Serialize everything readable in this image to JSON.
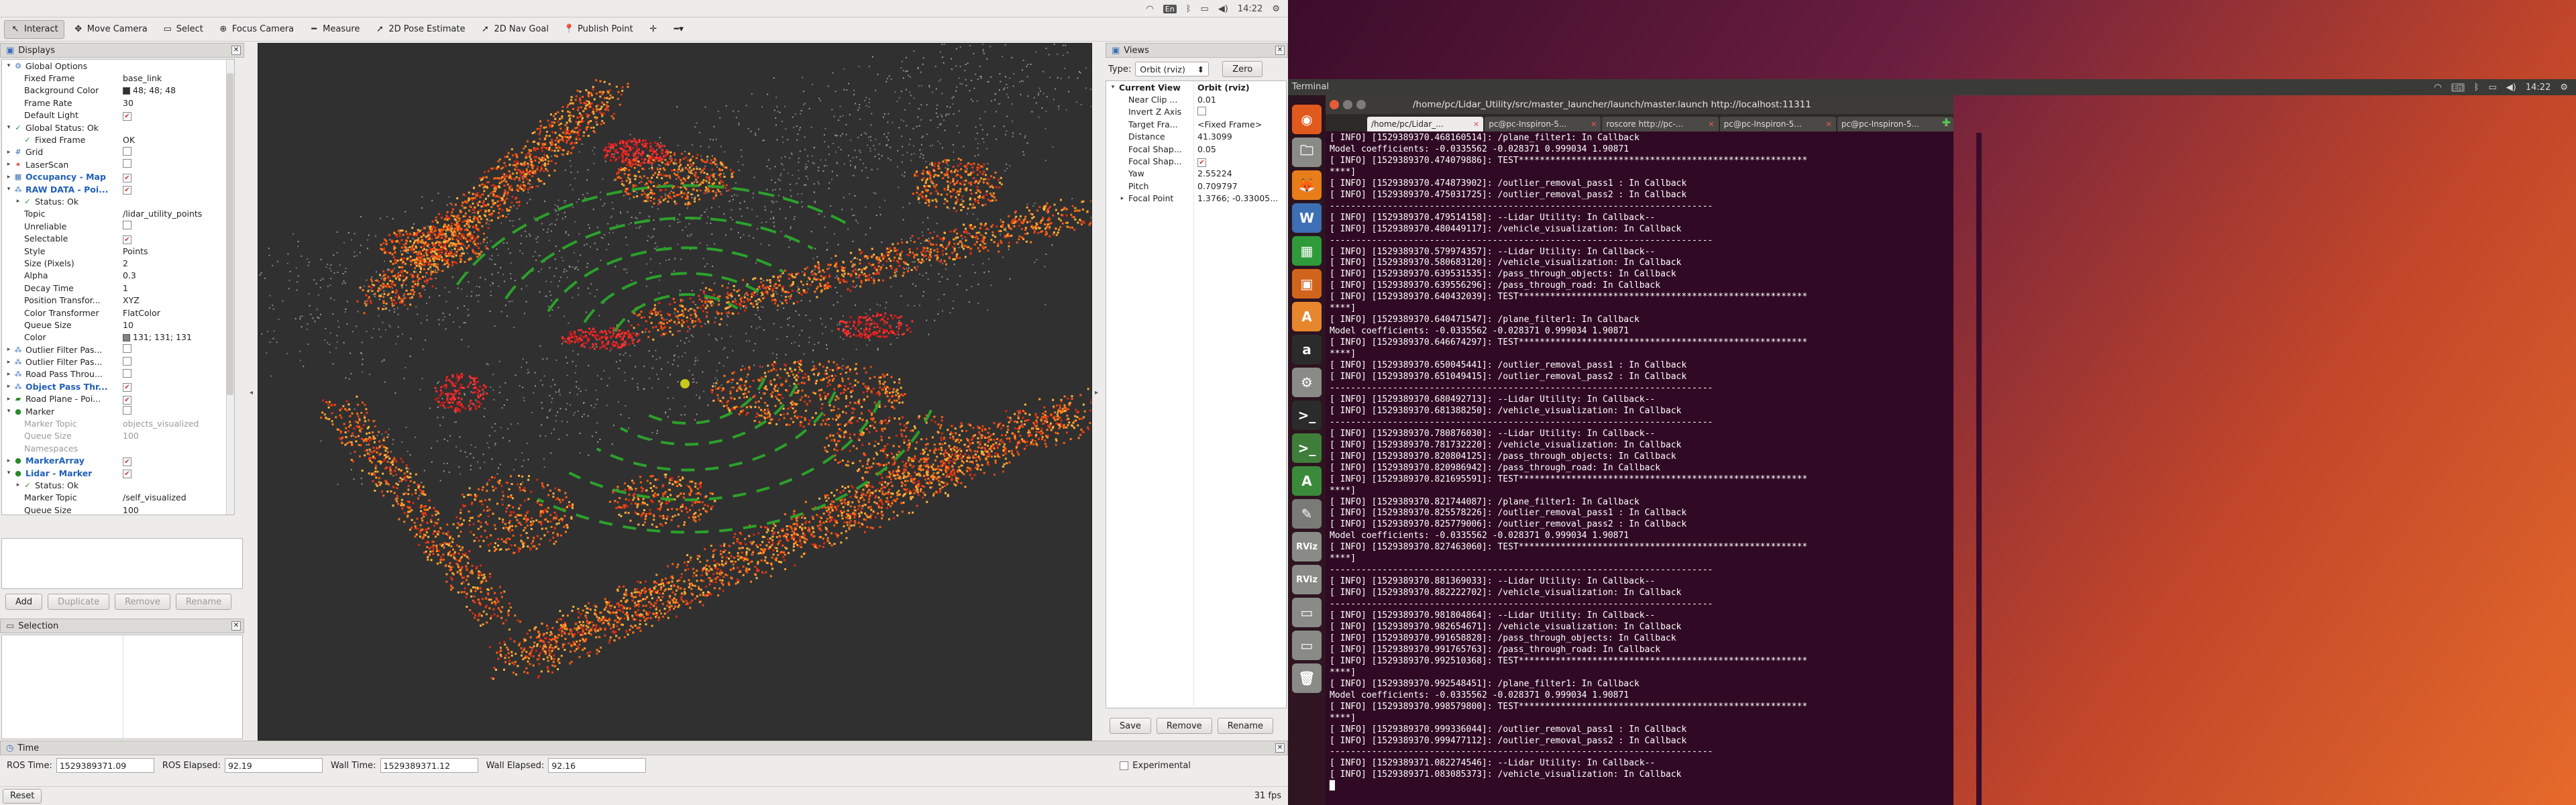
{
  "rviz": {
    "tray": {
      "time": "14:22",
      "en": "En"
    },
    "toolbar": [
      {
        "name": "interact",
        "label": "Interact",
        "icon": "↖",
        "active": true
      },
      {
        "name": "move-camera",
        "label": "Move Camera",
        "icon": "✥"
      },
      {
        "name": "select",
        "label": "Select",
        "icon": "▭"
      },
      {
        "name": "focus-camera",
        "label": "Focus Camera",
        "icon": "⊕"
      },
      {
        "name": "measure",
        "label": "Measure",
        "icon": "━"
      },
      {
        "name": "pose-estimate",
        "label": "2D Pose Estimate",
        "icon": "➚"
      },
      {
        "name": "nav-goal",
        "label": "2D Nav Goal",
        "icon": "➚"
      },
      {
        "name": "publish-point",
        "label": "Publish Point",
        "icon": "📍"
      },
      {
        "name": "plus-tool",
        "label": "",
        "icon": "✛"
      },
      {
        "name": "more-tools",
        "label": "",
        "icon": "━▾"
      }
    ],
    "displays_title": "Displays",
    "display_rows": [
      {
        "d": 0,
        "arrow": "▾",
        "icon": "⚙",
        "icolor": "#3a6fb5",
        "k": "Global Options",
        "v": ""
      },
      {
        "d": 1,
        "k": "Fixed Frame",
        "v": "base_link"
      },
      {
        "d": 1,
        "k": "Background Color",
        "v": "48; 48; 48",
        "swatch": "#303030"
      },
      {
        "d": 1,
        "k": "Frame Rate",
        "v": "30"
      },
      {
        "d": 1,
        "k": "Default Light",
        "chk": true
      },
      {
        "d": 0,
        "arrow": "▾",
        "icon": "✓",
        "icolor": "#2a8a2a",
        "k": "Global Status: Ok",
        "v": ""
      },
      {
        "d": 1,
        "icon": "✓",
        "icolor": "#2a8a2a",
        "k": "Fixed Frame",
        "v": "OK"
      },
      {
        "d": 0,
        "arrow": "▸",
        "icon": "#",
        "icolor": "#3a6fb5",
        "k": "Grid",
        "chk": false
      },
      {
        "d": 0,
        "arrow": "▸",
        "icon": "✶",
        "icolor": "#d33",
        "k": "LaserScan",
        "chk": false
      },
      {
        "d": 0,
        "arrow": "▸",
        "icon": "▦",
        "icolor": "#3a6fb5",
        "k": "Occupancy - Map",
        "blue": true,
        "chk": true
      },
      {
        "d": 0,
        "arrow": "▾",
        "icon": "⁂",
        "icolor": "#3a6fb5",
        "k": "RAW DATA - Poi...",
        "blue": true,
        "chk": true
      },
      {
        "d": 1,
        "arrow": "▸",
        "icon": "✓",
        "icolor": "#2a8a2a",
        "k": "Status: Ok",
        "v": ""
      },
      {
        "d": 1,
        "k": "Topic",
        "v": "/lidar_utility_points"
      },
      {
        "d": 1,
        "k": "Unreliable",
        "chk": false
      },
      {
        "d": 1,
        "k": "Selectable",
        "chk": true
      },
      {
        "d": 1,
        "k": "Style",
        "v": "Points"
      },
      {
        "d": 1,
        "k": "Size (Pixels)",
        "v": "2"
      },
      {
        "d": 1,
        "k": "Alpha",
        "v": "0.3"
      },
      {
        "d": 1,
        "k": "Decay Time",
        "v": "1"
      },
      {
        "d": 1,
        "k": "Position Transfor...",
        "v": "XYZ"
      },
      {
        "d": 1,
        "k": "Color Transformer",
        "v": "FlatColor"
      },
      {
        "d": 1,
        "k": "Queue Size",
        "v": "10"
      },
      {
        "d": 1,
        "k": "Color",
        "v": "131; 131; 131",
        "swatch": "#838383"
      },
      {
        "d": 0,
        "arrow": "▸",
        "icon": "⁂",
        "icolor": "#3a6fb5",
        "k": "Outlier Filter Pas...",
        "chk": false
      },
      {
        "d": 0,
        "arrow": "▸",
        "icon": "⁂",
        "icolor": "#3a6fb5",
        "k": "Outlier Filter Pas...",
        "chk": false
      },
      {
        "d": 0,
        "arrow": "▸",
        "icon": "⁂",
        "icolor": "#3a6fb5",
        "k": "Road Pass Throu...",
        "chk": false
      },
      {
        "d": 0,
        "arrow": "▸",
        "icon": "⁂",
        "icolor": "#3a6fb5",
        "k": "Object Pass Thr...",
        "blue": true,
        "chk": true
      },
      {
        "d": 0,
        "arrow": "▸",
        "icon": "▰",
        "icolor": "#2a8a2a",
        "k": "Road Plane - Poi...",
        "chk": true
      },
      {
        "d": 0,
        "arrow": "▾",
        "icon": "●",
        "icolor": "#2a8a2a",
        "k": "Marker",
        "chk": false
      },
      {
        "d": 1,
        "k": "Marker Topic",
        "v": "objects_visualized",
        "grey": true
      },
      {
        "d": 1,
        "k": "Queue Size",
        "v": "100",
        "grey": true
      },
      {
        "d": 1,
        "k": "Namespaces",
        "v": "",
        "grey": true
      },
      {
        "d": 0,
        "arrow": "▸",
        "icon": "●",
        "icolor": "#2a8a2a",
        "k": "MarkerArray",
        "blue": true,
        "chk": true
      },
      {
        "d": 0,
        "arrow": "▾",
        "icon": "●",
        "icolor": "#2a8a2a",
        "k": "Lidar - Marker",
        "blue": true,
        "chk": true
      },
      {
        "d": 1,
        "arrow": "▸",
        "icon": "✓",
        "icolor": "#2a8a2a",
        "k": "Status: Ok",
        "v": ""
      },
      {
        "d": 1,
        "k": "Marker Topic",
        "v": "/self_visualized"
      },
      {
        "d": 1,
        "k": "Queue Size",
        "v": "100"
      }
    ],
    "display_buttons": [
      "Add",
      "Duplicate",
      "Remove",
      "Rename"
    ],
    "selection_title": "Selection",
    "views_title": "Views",
    "views_type_label": "Type:",
    "views_type_value": "Orbit (rviz)",
    "views_zero": "Zero",
    "view_rows": [
      {
        "d": 0,
        "arrow": "▾",
        "k": "Current View",
        "v": "Orbit (rviz)",
        "bold": true
      },
      {
        "d": 1,
        "k": "Near Clip ...",
        "v": "0.01"
      },
      {
        "d": 1,
        "k": "Invert Z Axis",
        "chk": false
      },
      {
        "d": 1,
        "k": "Target Fra...",
        "v": "<Fixed Frame>"
      },
      {
        "d": 1,
        "k": "Distance",
        "v": "41.3099"
      },
      {
        "d": 1,
        "k": "Focal Shap...",
        "v": "0.05"
      },
      {
        "d": 1,
        "k": "Focal Shap...",
        "chk": true
      },
      {
        "d": 1,
        "k": "Yaw",
        "v": "2.55224"
      },
      {
        "d": 1,
        "k": "Pitch",
        "v": "0.709797"
      },
      {
        "d": 1,
        "arrow": "▸",
        "k": "Focal Point",
        "v": "1.3766; -0.33005..."
      }
    ],
    "views_buttons": [
      "Save",
      "Remove",
      "Rename"
    ],
    "time_title": "Time",
    "time": {
      "ros_time_label": "ROS Time:",
      "ros_time": "1529389371.09",
      "ros_elapsed_label": "ROS Elapsed:",
      "ros_elapsed": "92.19",
      "wall_time_label": "Wall Time:",
      "wall_time": "1529389371.12",
      "wall_elapsed_label": "Wall Elapsed:",
      "wall_elapsed": "92.16",
      "experimental": "Experimental"
    },
    "reset": "Reset",
    "fps": "31 fps"
  },
  "desktop": {
    "panel_title": "Terminal",
    "tray": {
      "time": "14:22",
      "en": "En"
    },
    "terminal_title": "/home/pc/Lidar_Utility/src/master_launcher/launch/master.launch http://localhost:11311",
    "tabs": [
      "/home/pc/Lidar_...",
      "pc@pc-Inspiron-5...",
      "roscore http://pc-...",
      "pc@pc-Inspiron-5...",
      "pc@pc-Inspiron-5..."
    ],
    "launcher": [
      {
        "name": "ubuntu-dash-icon",
        "glyph": "◉",
        "bg": "#e05a1e"
      },
      {
        "name": "files-icon",
        "glyph": "🗀",
        "bg": "#8a8a86"
      },
      {
        "name": "firefox-icon",
        "glyph": "🦊",
        "bg": "#e87d1a"
      },
      {
        "name": "writer-icon",
        "glyph": "W",
        "bg": "#3d6fb4"
      },
      {
        "name": "calc-icon",
        "glyph": "▦",
        "bg": "#2f9a3a"
      },
      {
        "name": "impress-icon",
        "glyph": "▣",
        "bg": "#d1641c"
      },
      {
        "name": "software-center-icon",
        "glyph": "A",
        "bg": "#e8862e"
      },
      {
        "name": "amazon-icon",
        "glyph": "a",
        "bg": "#2b2b2b"
      },
      {
        "name": "settings-icon",
        "glyph": "⚙",
        "bg": "#8a8a86"
      },
      {
        "name": "terminal-icon",
        "glyph": ">_",
        "bg": "#2b2b2b"
      },
      {
        "name": "terminal-icon-2",
        "glyph": ">_",
        "bg": "#3f7e3a"
      },
      {
        "name": "atom-icon",
        "glyph": "A",
        "bg": "#3b8a3b"
      },
      {
        "name": "text-editor-icon",
        "glyph": "✎",
        "bg": "#7a7a76"
      },
      {
        "name": "rviz-icon",
        "glyph": "RViz",
        "bg": "#8a8a86"
      },
      {
        "name": "rviz-icon-2",
        "glyph": "RViz",
        "bg": "#8a8a86"
      },
      {
        "name": "drive-icon",
        "glyph": "▭",
        "bg": "#8a8a86"
      },
      {
        "name": "drive-icon-2",
        "glyph": "▭",
        "bg": "#8a8a86"
      },
      {
        "name": "trash-icon",
        "glyph": "🗑",
        "bg": "#8a8a86"
      }
    ],
    "terminal_lines": [
      "[ INFO] [1529389370.468160514]: /plane_filter1: In Callback",
      "Model coefficients: -0.0335562 -0.028371 0.999034 1.90871",
      "[ INFO] [1529389370.474079886]: TEST*******************************************************",
      "****]",
      "[ INFO] [1529389370.474873902]: /outlier_removal_pass1 : In Callback",
      "[ INFO] [1529389370.475031725]: /outlier_removal_pass2 : In Callback",
      "-------------------------------------------------------------------------",
      "[ INFO] [1529389370.479514158]: --Lidar Utility: In Callback--",
      "[ INFO] [1529389370.480449117]: /vehicle_visualization: In Callback",
      "-------------------------------------------------------------------------",
      "[ INFO] [1529389370.579974357]: --Lidar Utility: In Callback--",
      "[ INFO] [1529389370.580683120]: /vehicle_visualization: In Callback",
      "[ INFO] [1529389370.639531535]: /pass_through_objects: In Callback",
      "[ INFO] [1529389370.639556296]: /pass_through_road: In Callback",
      "[ INFO] [1529389370.640432039]: TEST*******************************************************",
      "****]",
      "[ INFO] [1529389370.640471547]: /plane_filter1: In Callback",
      "Model coefficients: -0.0335562 -0.028371 0.999034 1.90871",
      "[ INFO] [1529389370.646674297]: TEST*******************************************************",
      "****]",
      "[ INFO] [1529389370.650045441]: /outlier_removal_pass1 : In Callback",
      "[ INFO] [1529389370.651049415]: /outlier_removal_pass2 : In Callback",
      "-------------------------------------------------------------------------",
      "[ INFO] [1529389370.680492713]: --Lidar Utility: In Callback--",
      "[ INFO] [1529389370.681388250]: /vehicle_visualization: In Callback",
      "-------------------------------------------------------------------------",
      "[ INFO] [1529389370.780876030]: --Lidar Utility: In Callback--",
      "[ INFO] [1529389370.781732220]: /vehicle_visualization: In Callback",
      "[ INFO] [1529389370.820804125]: /pass_through_objects: In Callback",
      "[ INFO] [1529389370.820986942]: /pass_through_road: In Callback",
      "[ INFO] [1529389370.821695591]: TEST*******************************************************",
      "****]",
      "[ INFO] [1529389370.821744087]: /plane_filter1: In Callback",
      "[ INFO] [1529389370.825578226]: /outlier_removal_pass1 : In Callback",
      "[ INFO] [1529389370.825779006]: /outlier_removal_pass2 : In Callback",
      "Model coefficients: -0.0335562 -0.028371 0.999034 1.90871",
      "[ INFO] [1529389370.827463060]: TEST*******************************************************",
      "****]",
      "-------------------------------------------------------------------------",
      "[ INFO] [1529389370.881369033]: --Lidar Utility: In Callback--",
      "[ INFO] [1529389370.882222702]: /vehicle_visualization: In Callback",
      "-------------------------------------------------------------------------",
      "[ INFO] [1529389370.981804864]: --Lidar Utility: In Callback--",
      "[ INFO] [1529389370.982654671]: /vehicle_visualization: In Callback",
      "[ INFO] [1529389370.991658828]: /pass_through_objects: In Callback",
      "[ INFO] [1529389370.991765763]: /pass_through_road: In Callback",
      "[ INFO] [1529389370.992510368]: TEST*******************************************************",
      "****]",
      "[ INFO] [1529389370.992548451]: /plane_filter1: In Callback",
      "Model coefficients: -0.0335562 -0.028371 0.999034 1.90871",
      "[ INFO] [1529389370.998579800]: TEST*******************************************************",
      "****]",
      "[ INFO] [1529389370.999336044]: /outlier_removal_pass1 : In Callback",
      "[ INFO] [1529389370.999477112]: /outlier_removal_pass2 : In Callback",
      "-------------------------------------------------------------------------",
      "[ INFO] [1529389371.082274546]: --Lidar Utility: In Callback--",
      "[ INFO] [1529389371.083085373]: /vehicle_visualization: In Callback",
      "█"
    ]
  }
}
